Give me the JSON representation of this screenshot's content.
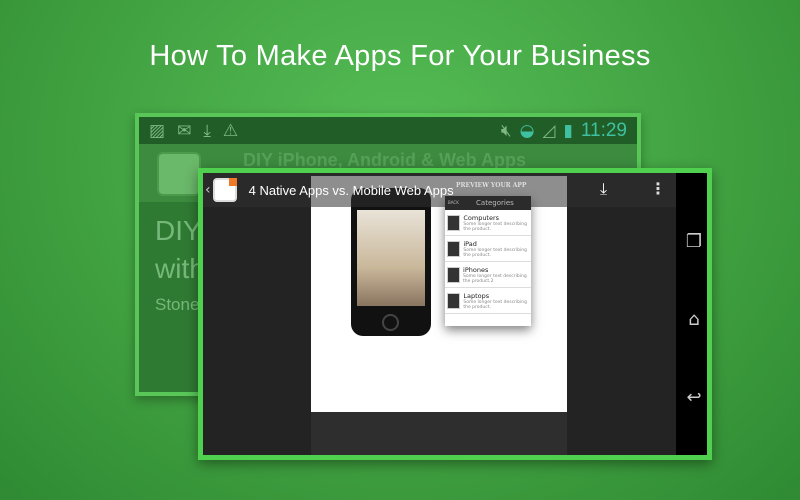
{
  "title": "How To Make Apps For Your Business",
  "back_screen": {
    "status_time": "11:29",
    "status_icons": [
      "image-icon",
      "gmail-icon",
      "download-icon",
      "warning-icon",
      "mute-icon",
      "wifi-icon",
      "signal-icon",
      "battery-icon"
    ],
    "header_title": "DIY iPhone, Android & Web Apps",
    "line1": "DIY",
    "line2": "with",
    "line3": "Stone"
  },
  "player": {
    "title": "4  Native Apps vs. Mobile Web Apps",
    "slide_heading": "PREVIEW YOUR APP",
    "panel_title": "Categories",
    "back_label": "BACK",
    "items": [
      {
        "name": "Computers",
        "desc": "Some longer text describing the product."
      },
      {
        "name": "iPad",
        "desc": "Some longer text describing the product."
      },
      {
        "name": "iPhones",
        "desc": "Some longer text describing the product.2"
      },
      {
        "name": "Laptops",
        "desc": "Some longer text describing the product."
      }
    ]
  }
}
